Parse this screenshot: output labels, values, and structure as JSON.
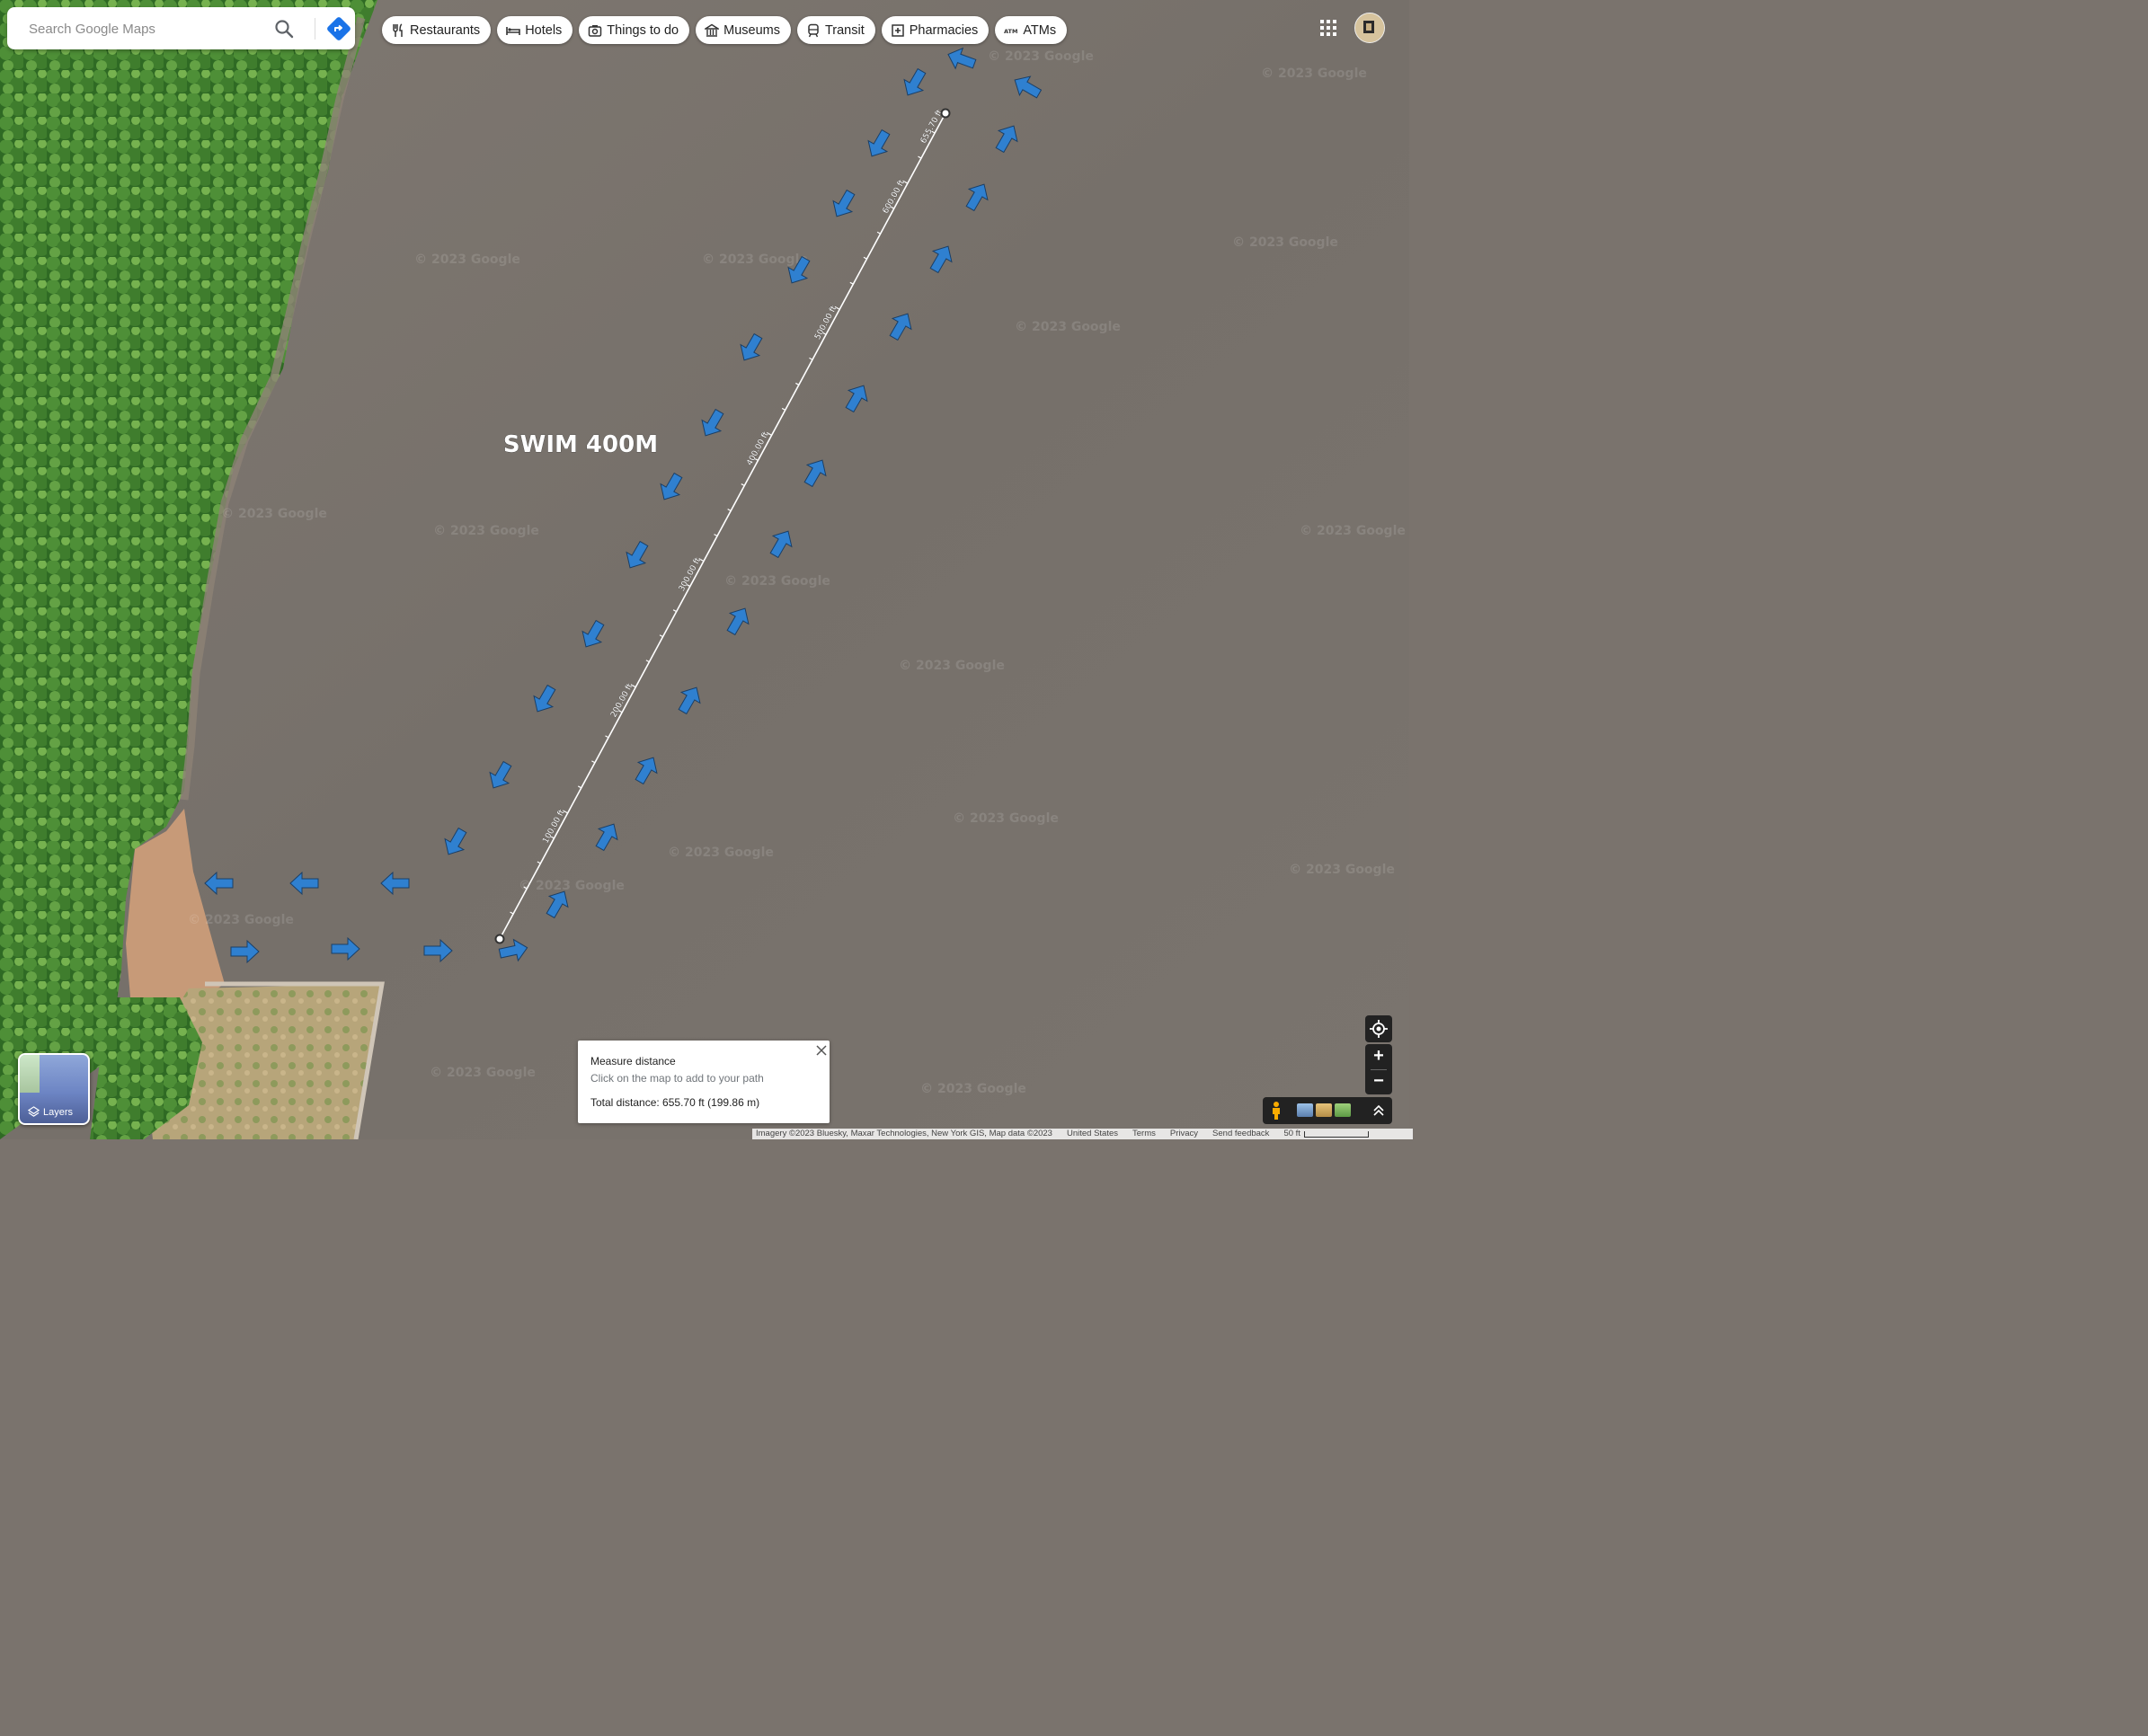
{
  "search": {
    "placeholder": "Search Google Maps"
  },
  "chips": [
    {
      "label": "Restaurants",
      "icon": "fork-knife-icon"
    },
    {
      "label": "Hotels",
      "icon": "bed-icon"
    },
    {
      "label": "Things to do",
      "icon": "camera-icon"
    },
    {
      "label": "Museums",
      "icon": "museum-icon"
    },
    {
      "label": "Transit",
      "icon": "train-icon"
    },
    {
      "label": "Pharmacies",
      "icon": "pharmacy-icon"
    },
    {
      "label": "ATMs",
      "icon": "atm-icon"
    }
  ],
  "map": {
    "overlay_label": "SWIM 400M",
    "watermark": "© 2023 Google",
    "measure_ticks": [
      "100.00 ft",
      "200.00 ft",
      "300.00 ft",
      "400.00 ft",
      "500.00 ft",
      "600.00 ft",
      "655.70 ft"
    ]
  },
  "layers": {
    "label": "Layers"
  },
  "measure": {
    "title": "Measure distance",
    "hint": "Click on the map to add to your path",
    "total": "Total distance: 655.70 ft (199.86 m)"
  },
  "footer": {
    "imagery": "Imagery ©2023 Bluesky, Maxar Technologies, New York GIS, Map data ©2023",
    "country": "United States",
    "terms": "Terms",
    "privacy": "Privacy",
    "feedback": "Send feedback",
    "scale": "50 ft"
  },
  "colors": {
    "water": "#7b746e",
    "arrow": "#2f80d0",
    "forest": "#3d7a2f",
    "sand": "#c99b78"
  }
}
